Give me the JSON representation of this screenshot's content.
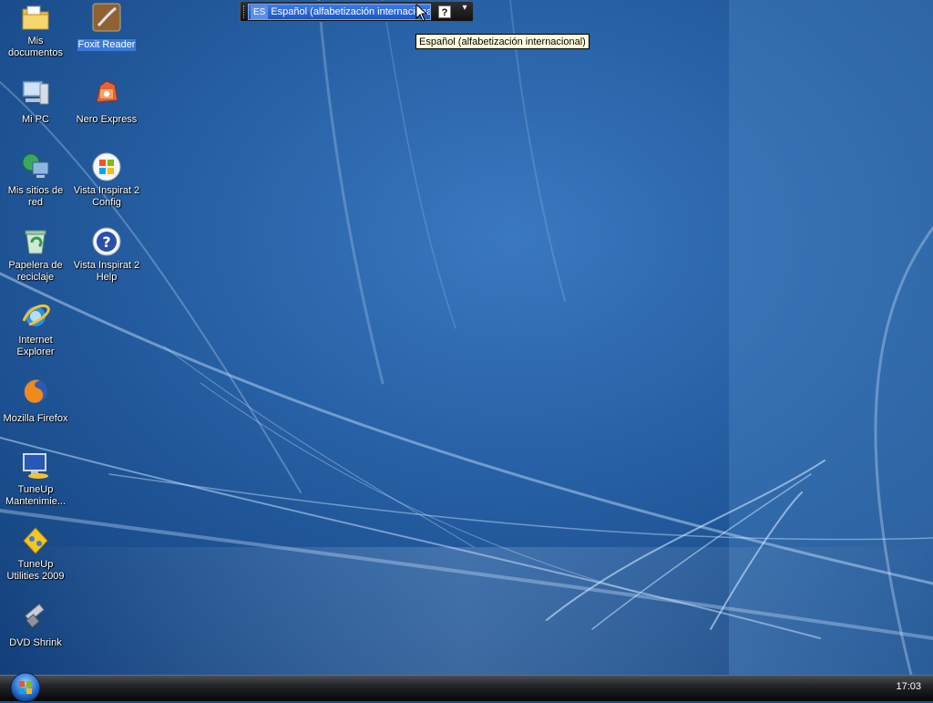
{
  "desktop": {
    "icons": [
      {
        "label": "Mis documentos",
        "icon": "folder-documents-icon"
      },
      {
        "label": "Foxit Reader",
        "icon": "foxit-reader-icon",
        "selected": true
      },
      {
        "label": "Mi PC",
        "icon": "computer-icon"
      },
      {
        "label": "Nero Express",
        "icon": "nero-express-icon"
      },
      {
        "label": "Mis sitios de red",
        "icon": "network-places-icon"
      },
      {
        "label": "Vista Inspirat 2 Config",
        "icon": "windows-logo-icon"
      },
      {
        "label": "Papelera de reciclaje",
        "icon": "recycle-bin-icon"
      },
      {
        "label": "Vista Inspirat 2 Help",
        "icon": "help-icon"
      },
      {
        "label": "Internet Explorer",
        "icon": "internet-explorer-icon"
      },
      {
        "label": "Mozilla Firefox",
        "icon": "firefox-icon"
      },
      {
        "label": "TuneUp Mantenimie...",
        "icon": "tuneup-maintenance-icon"
      },
      {
        "label": "TuneUp Utilities 2009",
        "icon": "tuneup-utilities-icon"
      },
      {
        "label": "DVD Shrink",
        "icon": "dvd-shrink-icon"
      }
    ]
  },
  "langbar": {
    "code": "ES",
    "language": "Español (alfabetización internacional)",
    "help_label": "?",
    "options_label": "▾"
  },
  "tooltip": {
    "text": "Español (alfabetización internacional)"
  },
  "taskbar": {
    "clock": "17:03",
    "start_icon": "windows-orb-icon"
  },
  "colors": {
    "wallpaper_base": "#1d4e8f",
    "selection": "#3a79d8",
    "tooltip_bg": "#ffffe1"
  }
}
